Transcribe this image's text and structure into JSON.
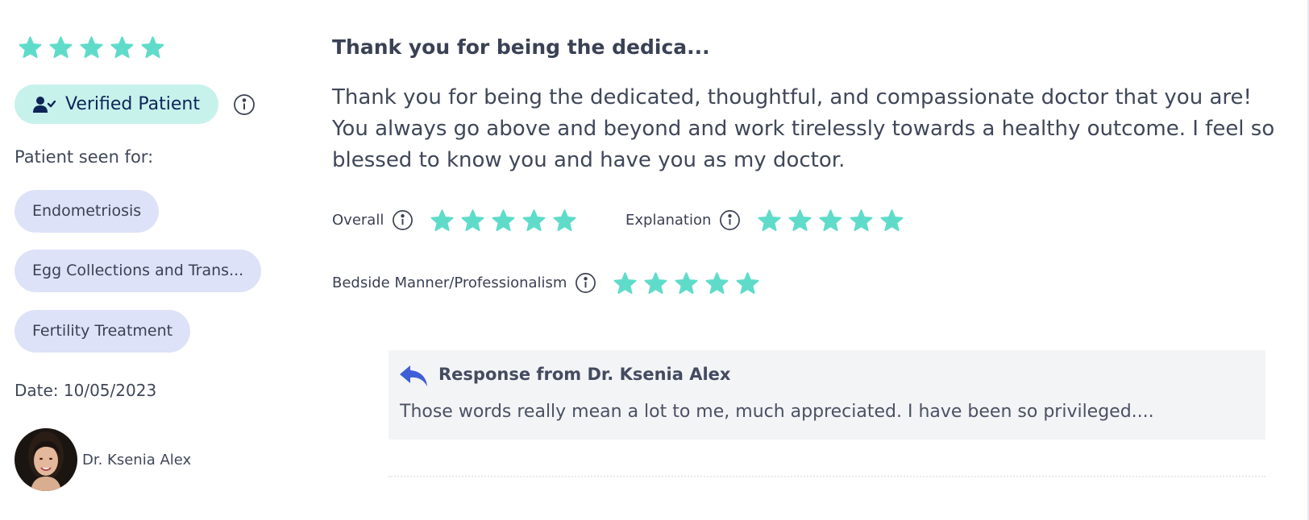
{
  "rating": {
    "overall_stars": 5,
    "max_stars": 5
  },
  "verified": {
    "label": "Verified Patient"
  },
  "seen_for": {
    "label": "Patient seen for:",
    "conditions": [
      "Endometriosis",
      "Egg Collections and Trans...",
      "Fertility Treatment"
    ]
  },
  "date": "Date: 10/05/2023",
  "doctor": {
    "name": "Dr. Ksenia Alex"
  },
  "review": {
    "title": "Thank you for being the dedica...",
    "body": "Thank you for being the dedicated, thoughtful, and compassionate doctor that you are! You always go above and beyond and work tirelessly towards a healthy outcome. I feel so blessed to know you and have you as my doctor."
  },
  "ratings": [
    {
      "label": "Overall",
      "stars": 5
    },
    {
      "label": "Explanation",
      "stars": 5
    },
    {
      "label": "Bedside Manner/Professionalism",
      "stars": 5
    }
  ],
  "response": {
    "title": "Response from Dr. Ksenia Alex",
    "text": "Those words really mean a lot to me, much appreciated. I have been so privileged...."
  },
  "colors": {
    "star": "#5fdcc9",
    "verified_bg": "#c7f2ec",
    "chip_bg": "#dde2f8",
    "reply_icon": "#3f5fd6"
  },
  "icons": {
    "info": "info-circle-icon",
    "reply": "reply-arrow-icon",
    "verified": "user-check-icon",
    "star": "star-icon"
  }
}
